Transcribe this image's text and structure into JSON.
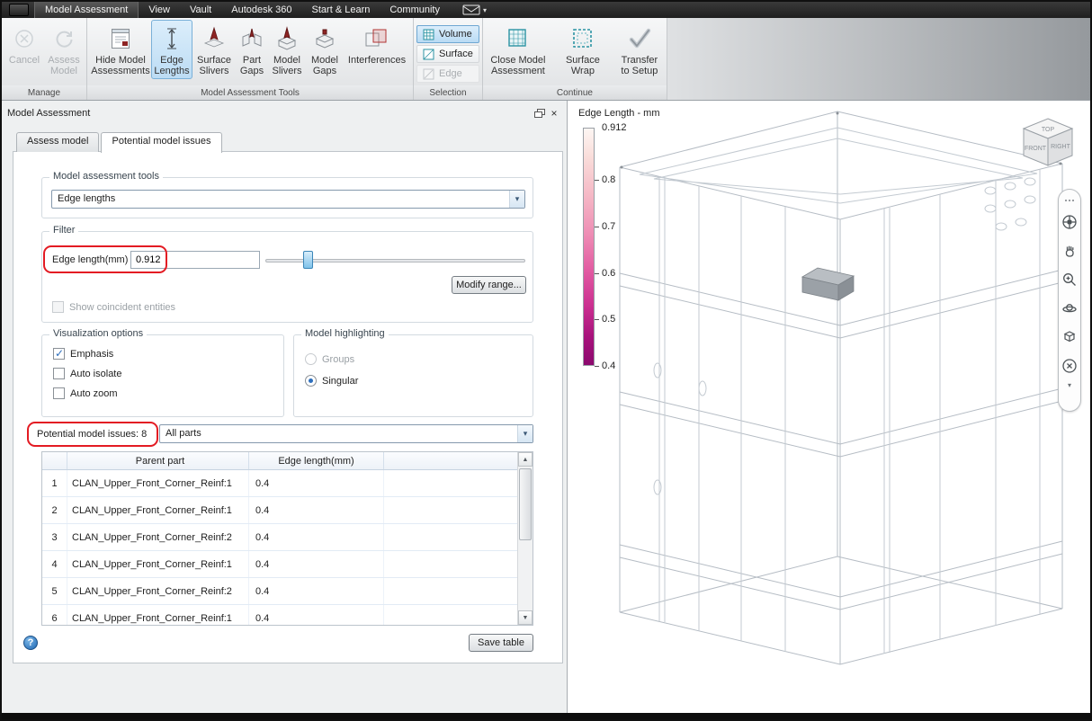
{
  "menu": {
    "items": [
      "Model Assessment",
      "View",
      "Vault",
      "Autodesk 360",
      "Start & Learn",
      "Community"
    ]
  },
  "ribbon": {
    "manage": {
      "group_label": "Manage",
      "cancel": "Cancel",
      "assess_model": "Assess Model"
    },
    "tools": {
      "group_label": "Model Assessment Tools",
      "hide_model_assessments": "Hide Model Assessments",
      "edge_lengths": "Edge Lengths",
      "surface_slivers": "Surface Slivers",
      "part_gaps": "Part Gaps",
      "model_slivers": "Model Slivers",
      "model_gaps": "Model Gaps",
      "interferences": "Interferences"
    },
    "selection": {
      "group_label": "Selection",
      "volume": "Volume",
      "surface": "Surface",
      "edge": "Edge"
    },
    "continue_group": {
      "group_label": "Continue",
      "close_model_assessment": "Close Model Assessment",
      "surface_wrap": "Surface Wrap",
      "transfer_to_setup": "Transfer to Setup"
    }
  },
  "panel": {
    "title": "Model Assessment",
    "tabs": {
      "assess_model": "Assess model",
      "potential_issues": "Potential model issues"
    },
    "tools_group": {
      "label": "Model assessment tools",
      "dropdown_value": "Edge lengths"
    },
    "filter_group": {
      "label": "Filter",
      "edge_length_label": "Edge length(mm)",
      "edge_length_value": "0.912",
      "modify_range": "Modify range...",
      "show_coincident": "Show coincident entities"
    },
    "visualization_group": {
      "label": "Visualization options",
      "emphasis": "Emphasis",
      "auto_isolate": "Auto isolate",
      "auto_zoom": "Auto zoom"
    },
    "highlighting_group": {
      "label": "Model highlighting",
      "groups_option": "Groups",
      "singular_option": "Singular"
    },
    "issues_label": "Potential model issues: 8",
    "issues_dropdown_value": "All parts",
    "table": {
      "headers": {
        "parent_part": "Parent part",
        "edge_length": "Edge length(mm)"
      },
      "rows": [
        {
          "num": "1",
          "parent_part": "CLAN_Upper_Front_Corner_Reinf:1",
          "edge_length": "0.4"
        },
        {
          "num": "2",
          "parent_part": "CLAN_Upper_Front_Corner_Reinf:1",
          "edge_length": "0.4"
        },
        {
          "num": "3",
          "parent_part": "CLAN_Upper_Front_Corner_Reinf:2",
          "edge_length": "0.4"
        },
        {
          "num": "4",
          "parent_part": "CLAN_Upper_Front_Corner_Reinf:1",
          "edge_length": "0.4"
        },
        {
          "num": "5",
          "parent_part": "CLAN_Upper_Front_Corner_Reinf:2",
          "edge_length": "0.4"
        },
        {
          "num": "6",
          "parent_part": "CLAN_Upper_Front_Corner_Reinf:1",
          "edge_length": "0.4"
        }
      ]
    },
    "save_table": "Save table"
  },
  "viewport": {
    "legend": {
      "title": "Edge Length - mm",
      "max_value": "0.912",
      "ticks": [
        "0.8",
        "0.7",
        "0.6",
        "0.5",
        "0.4"
      ],
      "gradient_top": "#fdf6f3",
      "gradient_bottom": "#8c096e"
    },
    "viewcube": {
      "top": "TOP",
      "front": "FRONT",
      "right": "RIGHT"
    }
  }
}
